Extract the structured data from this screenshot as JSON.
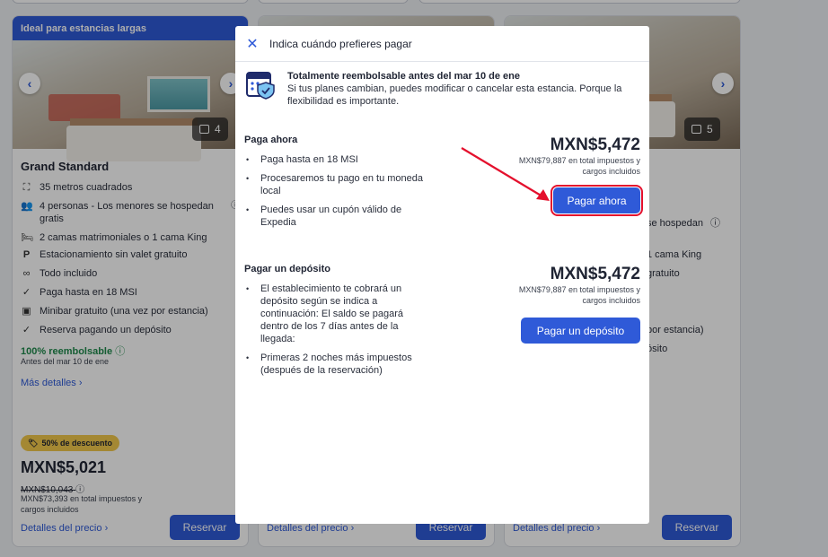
{
  "cards": [
    {
      "banner": "Ideal para estancias largas",
      "photo_count": "4",
      "title": "Grand Standard",
      "features": [
        {
          "icon": "ruler-icon",
          "glyph": "⛶",
          "text": "35 metros cuadrados"
        },
        {
          "icon": "people-icon",
          "glyph": "👥",
          "text": "4 personas - Los menores se hospedan gratis"
        },
        {
          "icon": "bed-icon",
          "glyph": "🛏",
          "text": "2 camas matrimoniales o 1 cama King"
        },
        {
          "icon": "parking-icon",
          "glyph": "P",
          "text": "Estacionamiento sin valet gratuito"
        },
        {
          "icon": "infinity-icon",
          "glyph": "∞",
          "text": "Todo incluido"
        },
        {
          "icon": "check-icon",
          "glyph": "✓",
          "text": "Paga hasta en 18 MSI"
        },
        {
          "icon": "minibar-icon",
          "glyph": "▣",
          "text": "Minibar gratuito (una vez por estancia)"
        },
        {
          "icon": "check-icon",
          "glyph": "✓",
          "text": "Reserva pagando un depósito"
        }
      ],
      "refund": "100% reembolsable",
      "refund_sub": "Antes del mar 10 de ene",
      "more": "Más detalles",
      "discount": "50% de descuento",
      "price": "MXN$5,021",
      "price_strike": "MXN$10,043",
      "price_total": "MXN$73,393 en total impuestos y cargos incluidos",
      "price_details": "Detalles del precio",
      "reserve": "Reservar"
    },
    {
      "price_details": "Detalles del precio",
      "reserve": "Reservar"
    },
    {
      "photo_count": "5",
      "partial_features": [
        "se hospedan",
        "1 cama King",
        "gratuito",
        "por estancia)",
        "ósito"
      ],
      "price_details": "Detalles del precio",
      "reserve": "Reservar"
    }
  ],
  "modal": {
    "title": "Indica cuándo prefieres pagar",
    "info_title": "Totalmente reembolsable antes del mar 10 de ene",
    "info_body": "Si tus planes cambian, puedes modificar o cancelar esta estancia. Porque la flexibilidad es importante.",
    "pay_now": {
      "title": "Paga ahora",
      "bullets": [
        "Paga hasta en 18 MSI",
        "Procesaremos tu pago en tu moneda local",
        "Puedes usar un cupón válido de Expedia"
      ],
      "price": "MXN$5,472",
      "price_sub": "MXN$79,887 en total impuestos y cargos incluidos",
      "button": "Pagar ahora"
    },
    "deposit": {
      "title": "Pagar un depósito",
      "bullets": [
        "El establecimiento te cobrará un depósito según se indica a continuación: El saldo se pagará dentro de los 7 días antes de la llegada:",
        "Primeras 2 noches más impuestos (después de la reservación)"
      ],
      "price": "MXN$5,472",
      "price_sub": "MXN$79,887 en total impuestos y cargos incluidos",
      "button": "Pagar un depósito"
    }
  },
  "colors": {
    "accent": "#2f5ad8",
    "highlight": "#e4102d",
    "discount": "#f2c94c",
    "refund": "#1f8a4c"
  }
}
